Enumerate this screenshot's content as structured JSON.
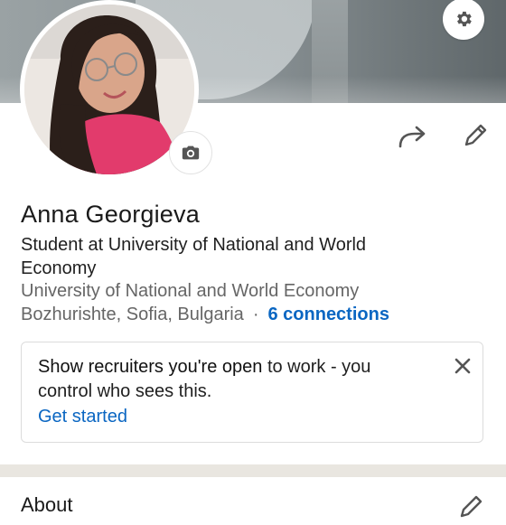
{
  "profile": {
    "name": "Anna Georgieva",
    "headline": "Student at University of National and World Economy",
    "organization": "University of National and World Economy",
    "location": "Bozhurishte, Sofia, Bulgaria",
    "separator": "·",
    "connections": "6 connections"
  },
  "open_to_work": {
    "message_strong": "Show recruiters you're open",
    "message_rest": " to work - you control who sees this.",
    "cta": "Get started"
  },
  "sections": {
    "about_title": "About"
  },
  "icons": {
    "settings": "gear-icon",
    "camera": "camera-icon",
    "share": "share-icon",
    "edit": "pencil-icon",
    "close": "close-icon"
  },
  "colors": {
    "link": "#0a66c2",
    "secondary_text": "#666666",
    "primary_text": "#1a1a1a",
    "divider": "#e9e6e0"
  }
}
